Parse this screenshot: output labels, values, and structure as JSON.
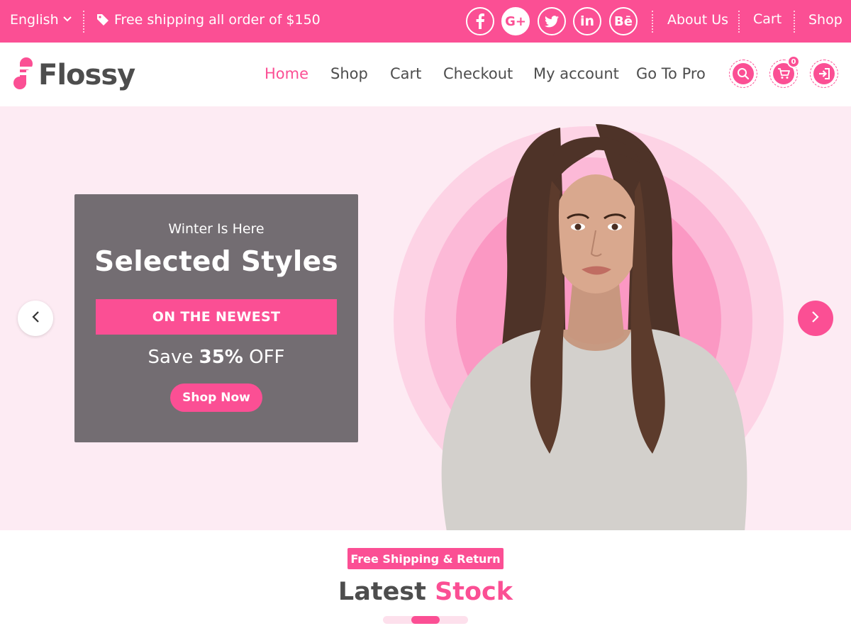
{
  "colors": {
    "accent": "#fb4f94",
    "hero_bg": "#fdebf3",
    "promo_box": "#736d72",
    "text_dark": "#4d4d4d"
  },
  "topbar": {
    "language": "English",
    "promo_text": "Free shipping all order of $150",
    "social": [
      {
        "icon": "facebook-icon",
        "glyph": "f"
      },
      {
        "icon": "google-plus-icon",
        "glyph": "G+"
      },
      {
        "icon": "twitter-icon",
        "glyph": ""
      },
      {
        "icon": "linkedin-icon",
        "glyph": "in"
      },
      {
        "icon": "behance-icon",
        "glyph": "Bē"
      }
    ],
    "links": [
      "About Us",
      "Cart",
      "Shop"
    ]
  },
  "header": {
    "logo": "Flossy",
    "nav": [
      "Home",
      "Shop",
      "Cart",
      "Checkout",
      "My account",
      "Go To Pro"
    ],
    "active_nav": "Home",
    "cart_count": "0"
  },
  "hero": {
    "subtitle": "Winter Is Here",
    "title": "Selected Styles",
    "banner": "ON THE NEWEST",
    "save_prefix": "Save",
    "save_value": "35%",
    "save_suffix": "OFF",
    "button": "Shop Now"
  },
  "section": {
    "badge": "Free Shipping & Return",
    "title_part1": "Latest",
    "title_part2": "Stock"
  }
}
